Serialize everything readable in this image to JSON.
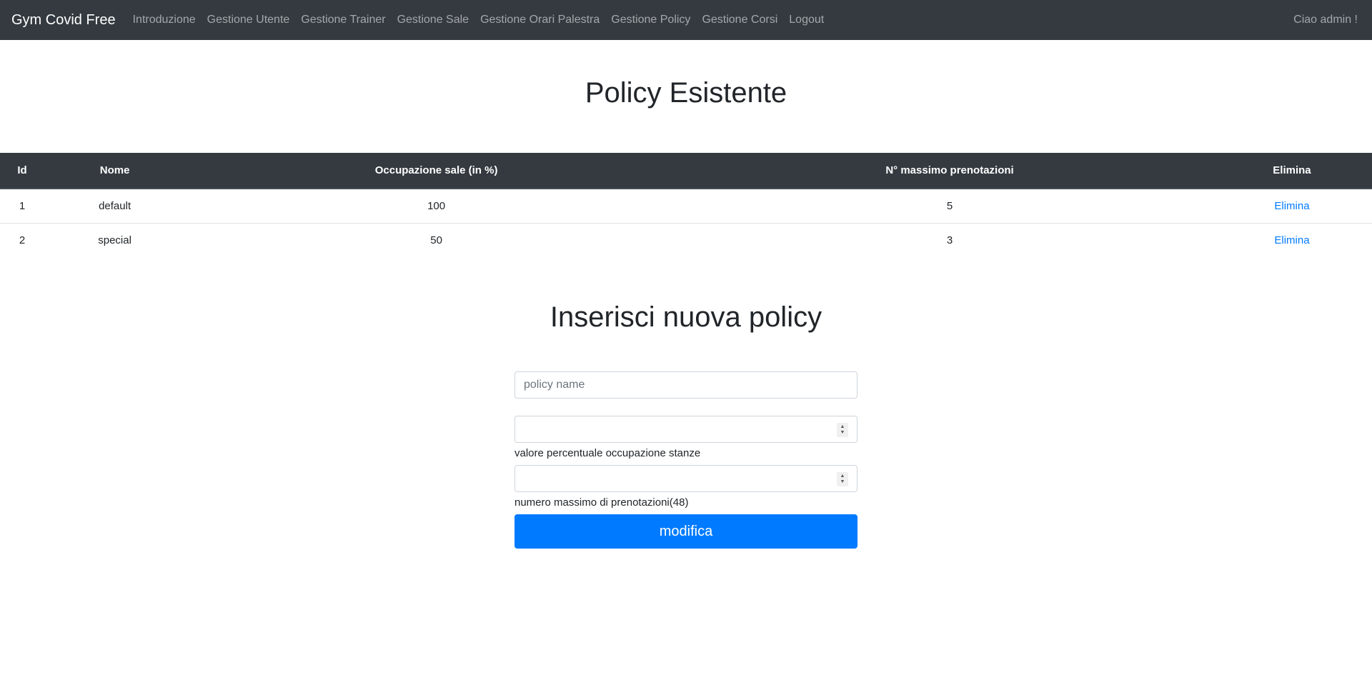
{
  "navbar": {
    "brand": "Gym Covid Free",
    "links": [
      "Introduzione",
      "Gestione Utente",
      "Gestione Trainer",
      "Gestione Sale",
      "Gestione Orari Palestra",
      "Gestione Policy",
      "Gestione Corsi",
      "Logout"
    ],
    "greeting": "Ciao admin !"
  },
  "existing": {
    "title": "Policy Esistente",
    "columns": [
      "Id",
      "Nome",
      "Occupazione sale (in %)",
      "N° massimo prenotazioni",
      "Elimina"
    ],
    "rows": [
      {
        "id": "1",
        "nome": "default",
        "occupazione": "100",
        "max": "5",
        "action": "Elimina"
      },
      {
        "id": "2",
        "nome": "special",
        "occupazione": "50",
        "max": "3",
        "action": "Elimina"
      }
    ]
  },
  "form": {
    "title": "Inserisci nuova policy",
    "name_placeholder": "policy name",
    "occupancy_value": "",
    "occupancy_help": "valore percentuale occupazione stanze",
    "bookings_value": "",
    "bookings_help": "numero massimo di prenotazioni(48)",
    "submit_label": "modifica"
  }
}
